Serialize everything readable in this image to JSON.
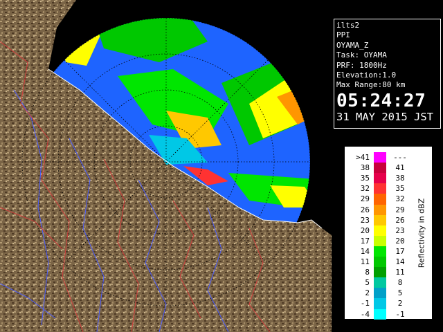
{
  "info": {
    "lines": [
      "ilts2",
      "PPI",
      "OYAMA_Z",
      "Task: OYAMA",
      "PRF: 1800Hz",
      "Elevation:1.0",
      "Max Range:80 km"
    ],
    "time": "05:24:27",
    "date": "31 MAY 2015 JST"
  },
  "legend": {
    "title": "Reflectivity in dBZ",
    "rows": [
      {
        "lo": ">41",
        "hi": "---",
        "color": "#ff00ff"
      },
      {
        "lo": "38",
        "hi": "41",
        "color": "#c8003c"
      },
      {
        "lo": "35",
        "hi": "38",
        "color": "#e6004b"
      },
      {
        "lo": "32",
        "hi": "35",
        "color": "#ff3232"
      },
      {
        "lo": "29",
        "hi": "32",
        "color": "#ff6400"
      },
      {
        "lo": "26",
        "hi": "29",
        "color": "#ff9600"
      },
      {
        "lo": "23",
        "hi": "26",
        "color": "#ffc800"
      },
      {
        "lo": "20",
        "hi": "23",
        "color": "#ffff00"
      },
      {
        "lo": "17",
        "hi": "20",
        "color": "#c8ff00"
      },
      {
        "lo": "14",
        "hi": "17",
        "color": "#00e600"
      },
      {
        "lo": "11",
        "hi": "14",
        "color": "#00c800"
      },
      {
        "lo": "8",
        "hi": "11",
        "color": "#00a000"
      },
      {
        "lo": "5",
        "hi": "8",
        "color": "#00c8a0"
      },
      {
        "lo": "2",
        "hi": "5",
        "color": "#00a0c8"
      },
      {
        "lo": "-1",
        "hi": "2",
        "color": "#00c8e6"
      },
      {
        "lo": "-4",
        "hi": "-1",
        "color": "#00ffff"
      }
    ]
  },
  "colors": {
    "terrain": "#7a6446",
    "terrain_dark": "#4e3a25",
    "terrain_light": "#b49c74",
    "rain_background": "#1e64ff",
    "sea": "#000000"
  }
}
